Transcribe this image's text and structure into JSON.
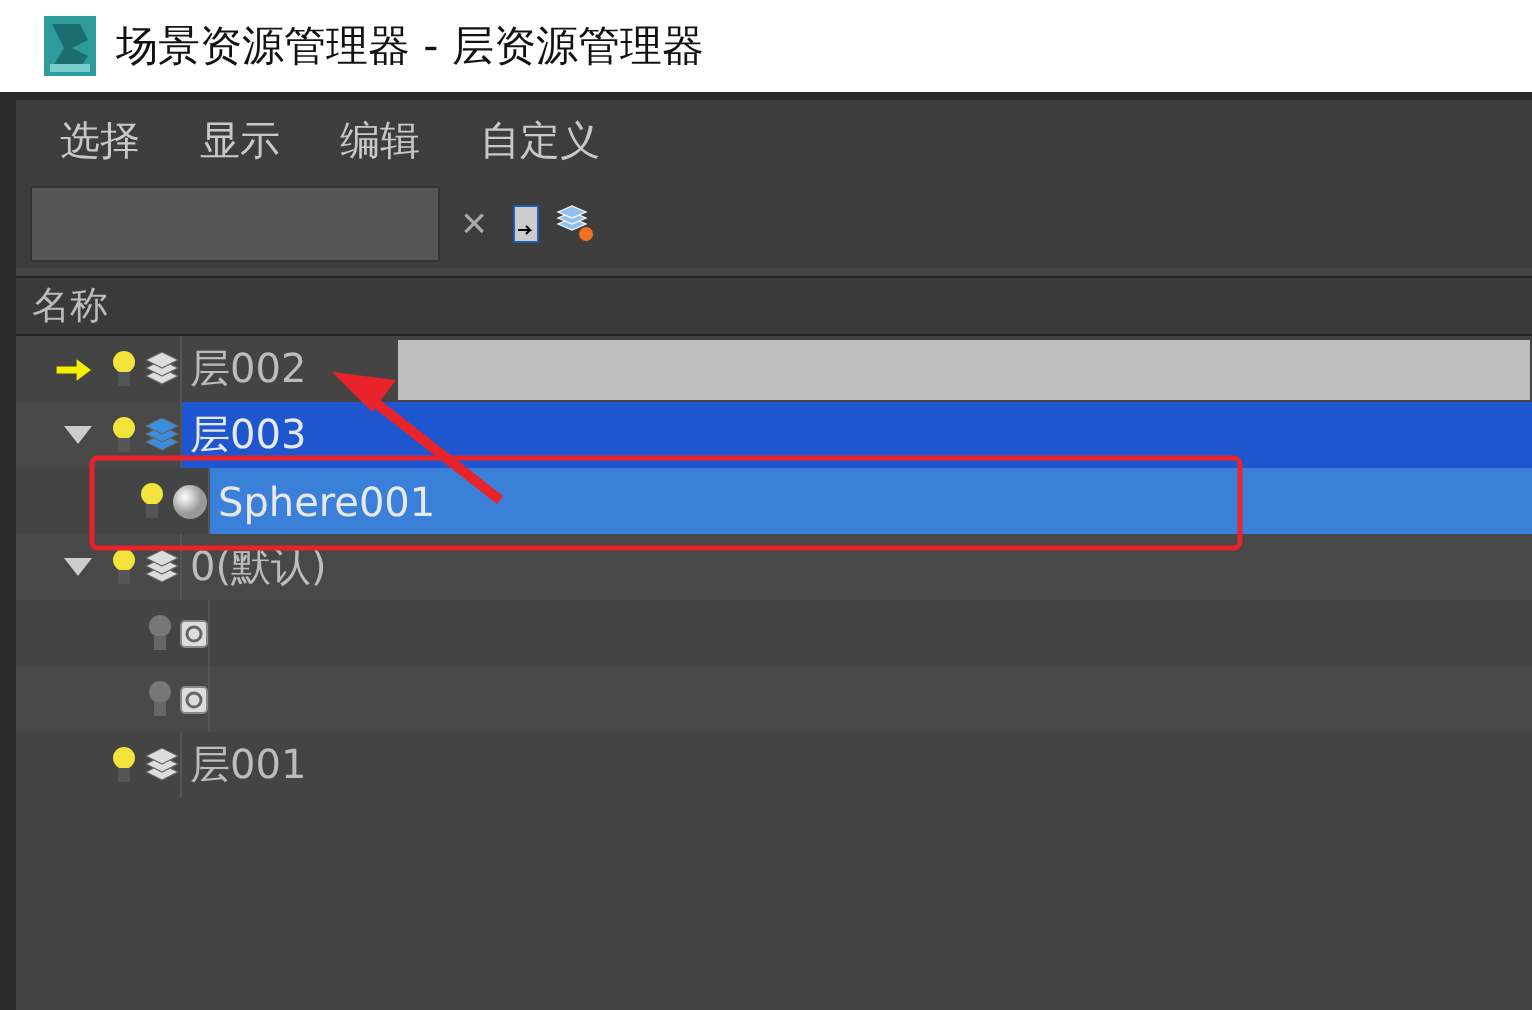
{
  "window": {
    "title": "场景资源管理器 - 层资源管理器"
  },
  "menu": [
    "选择",
    "显示",
    "编辑",
    "自定义"
  ],
  "toolbar": {
    "clear": "×"
  },
  "columns": [
    "名称"
  ],
  "tree": [
    {
      "kind": "layer",
      "name": "层002",
      "current": true,
      "visible": true,
      "selected": false
    },
    {
      "kind": "layer",
      "name": "层003",
      "current": false,
      "visible": true,
      "selected": true,
      "expanded": true,
      "children": [
        {
          "kind": "sphere",
          "name": "Sphere001",
          "visible": true,
          "selected": true
        }
      ]
    },
    {
      "kind": "layer",
      "name": "0(默认)",
      "current": false,
      "visible": true,
      "selected": false,
      "expanded": true,
      "children": [
        {
          "kind": "object",
          "visible": false,
          "selected": false
        },
        {
          "kind": "object",
          "visible": false,
          "selected": false
        }
      ]
    },
    {
      "kind": "layer",
      "name": "层001",
      "current": false,
      "visible": true,
      "selected": false
    }
  ]
}
